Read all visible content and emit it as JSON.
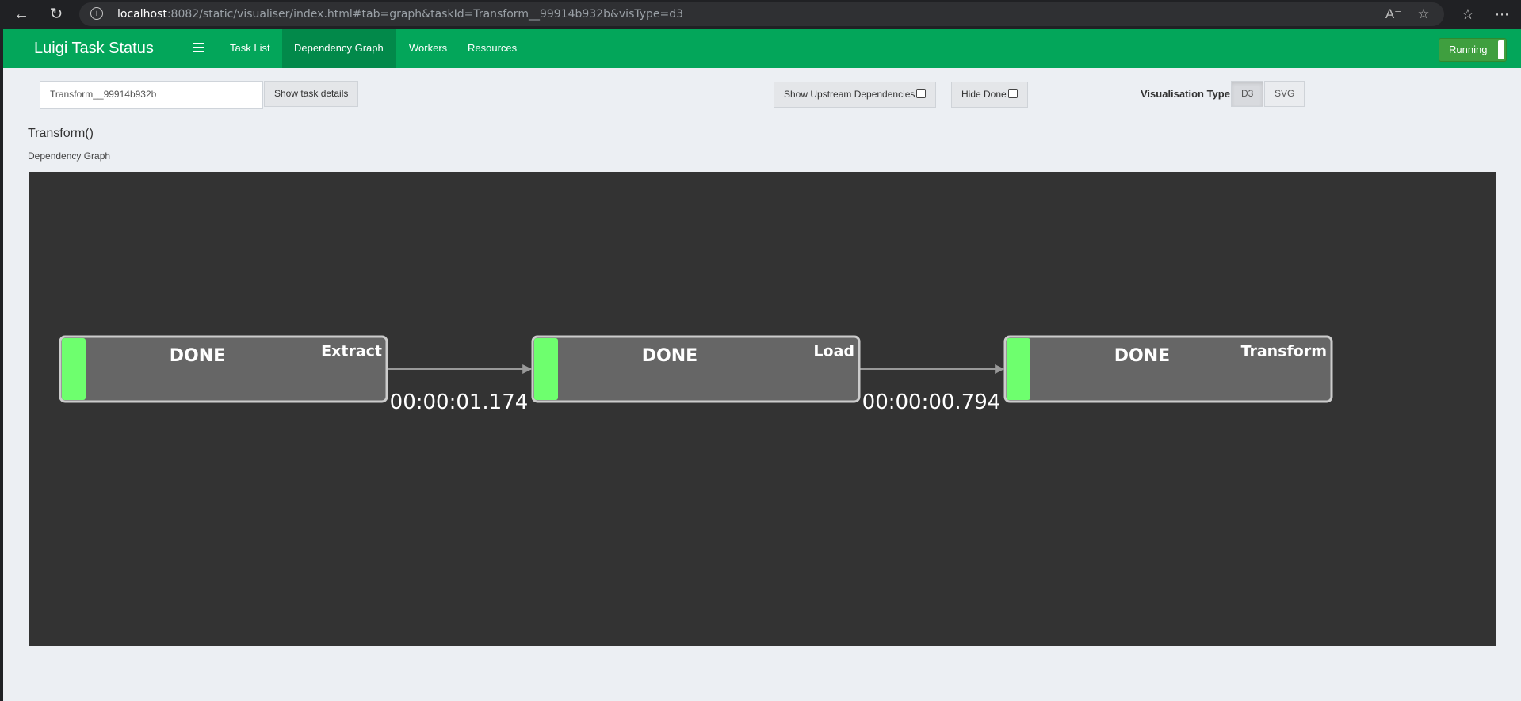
{
  "browser": {
    "url_host": "localhost",
    "url_rest": ":8082/static/visualiser/index.html#tab=graph&taskId=Transform__99914b932b&visType=d3"
  },
  "navbar": {
    "brand": "Luigi Task Status",
    "items": [
      {
        "label": "Task List",
        "active": false
      },
      {
        "label": "Dependency Graph",
        "active": true
      },
      {
        "label": "Workers",
        "active": false
      },
      {
        "label": "Resources",
        "active": false
      }
    ],
    "status_button": "Running"
  },
  "toolbar": {
    "task_id_value": "Transform__99914b932b",
    "show_details_label": "Show task details",
    "show_upstream_label": "Show Upstream Dependencies",
    "show_upstream_checked": false,
    "hide_done_label": "Hide Done",
    "hide_done_checked": false,
    "vis_type_label": "Visualisation Type",
    "vis_options": [
      "D3",
      "SVG"
    ],
    "vis_selected": "D3"
  },
  "page": {
    "title": "Transform()",
    "subtitle": "Dependency Graph"
  },
  "graph": {
    "colors": {
      "background": "#333333",
      "node_fill": "#666666",
      "node_stroke": "#cccccc",
      "status_bar": "#6eff6e",
      "edge": "#999999"
    },
    "nodes": [
      {
        "name": "Extract",
        "status": "DONE"
      },
      {
        "name": "Load",
        "status": "DONE"
      },
      {
        "name": "Transform",
        "status": "DONE"
      }
    ],
    "edges": [
      {
        "from": "Extract",
        "to": "Load",
        "label": "00:00:01.174"
      },
      {
        "from": "Load",
        "to": "Transform",
        "label": "00:00:00.794"
      }
    ]
  }
}
